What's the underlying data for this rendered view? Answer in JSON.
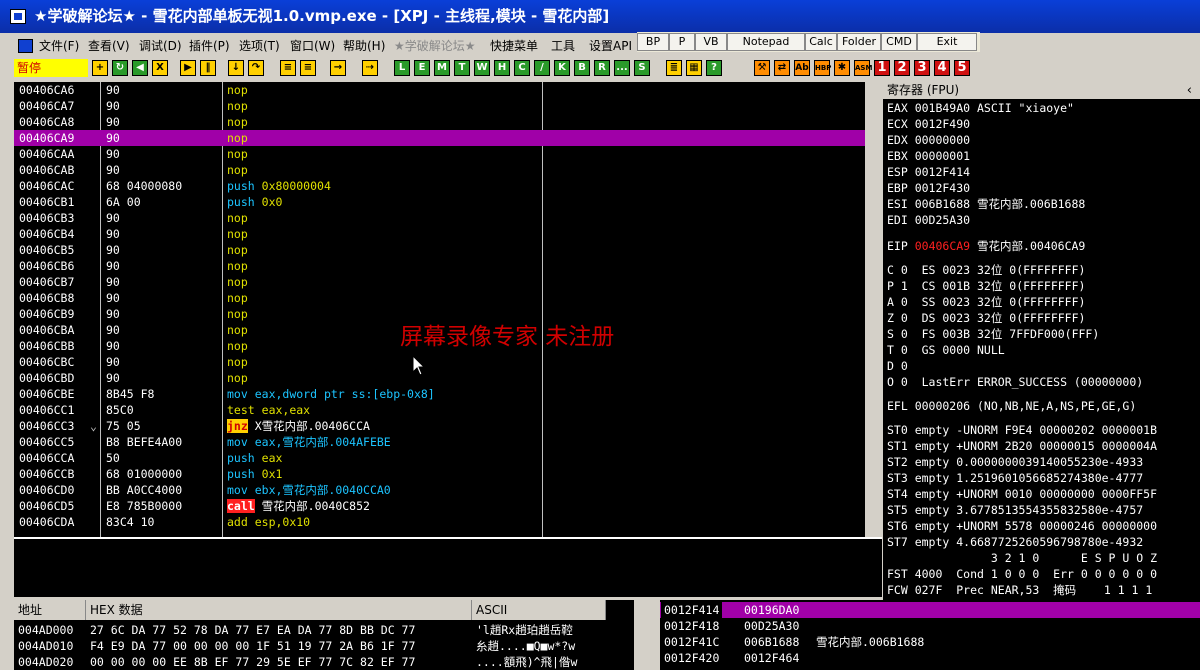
{
  "window": {
    "title": "★学破解论坛★ - 雪花内部单板无视1.0.vmp.exe - [XPJ - 主线程,模块 - 雪花内部]"
  },
  "menu": [
    {
      "label": "文件(F)",
      "disabled": false
    },
    {
      "label": "查看(V)",
      "disabled": false
    },
    {
      "label": "调试(D)",
      "disabled": false
    },
    {
      "label": "插件(P)",
      "disabled": false
    },
    {
      "label": "选项(T)",
      "disabled": false
    },
    {
      "label": "窗口(W)",
      "disabled": false
    },
    {
      "label": "帮助(H)",
      "disabled": false
    },
    {
      "label": "★学破解论坛★",
      "disabled": true
    },
    {
      "label": "快捷菜单",
      "disabled": false
    },
    {
      "label": "工具",
      "disabled": false
    },
    {
      "label": "设置API",
      "disabled": false
    }
  ],
  "plugin_buttons": [
    "BP",
    "P",
    "VB",
    "Notepad",
    "Calc",
    "Folder",
    "CMD",
    "Exit"
  ],
  "toolbar": {
    "status": "暂停",
    "letter_buttons": [
      "L",
      "E",
      "M",
      "T",
      "W",
      "H",
      "C",
      "/",
      "K",
      "B",
      "R",
      "...",
      "S"
    ],
    "number_buttons": [
      "1",
      "2",
      "3",
      "4",
      "5"
    ],
    "right_buttons": [
      "Ab",
      "HBP",
      "ASM"
    ]
  },
  "disassembly": [
    {
      "addr": "00406CA6",
      "hex": "90",
      "mnem": "nop",
      "op": "",
      "style": "plain"
    },
    {
      "addr": "00406CA7",
      "hex": "90",
      "mnem": "nop",
      "op": "",
      "style": "plain"
    },
    {
      "addr": "00406CA8",
      "hex": "90",
      "mnem": "nop",
      "op": "",
      "style": "plain"
    },
    {
      "addr": "00406CA9",
      "hex": "90",
      "mnem": "nop",
      "op": "",
      "style": "plain",
      "selected": true
    },
    {
      "addr": "00406CAA",
      "hex": "90",
      "mnem": "nop",
      "op": "",
      "style": "plain"
    },
    {
      "addr": "00406CAB",
      "hex": "90",
      "mnem": "nop",
      "op": "",
      "style": "plain"
    },
    {
      "addr": "00406CAC",
      "hex": "68 04000080",
      "mnem": "push",
      "op": "0x80000004",
      "style": "push"
    },
    {
      "addr": "00406CB1",
      "hex": "6A 00",
      "mnem": "push",
      "op": "0x0",
      "style": "push"
    },
    {
      "addr": "00406CB3",
      "hex": "90",
      "mnem": "nop",
      "op": "",
      "style": "plain"
    },
    {
      "addr": "00406CB4",
      "hex": "90",
      "mnem": "nop",
      "op": "",
      "style": "plain"
    },
    {
      "addr": "00406CB5",
      "hex": "90",
      "mnem": "nop",
      "op": "",
      "style": "plain"
    },
    {
      "addr": "00406CB6",
      "hex": "90",
      "mnem": "nop",
      "op": "",
      "style": "plain"
    },
    {
      "addr": "00406CB7",
      "hex": "90",
      "mnem": "nop",
      "op": "",
      "style": "plain"
    },
    {
      "addr": "00406CB8",
      "hex": "90",
      "mnem": "nop",
      "op": "",
      "style": "plain"
    },
    {
      "addr": "00406CB9",
      "hex": "90",
      "mnem": "nop",
      "op": "",
      "style": "plain"
    },
    {
      "addr": "00406CBA",
      "hex": "90",
      "mnem": "nop",
      "op": "",
      "style": "plain"
    },
    {
      "addr": "00406CBB",
      "hex": "90",
      "mnem": "nop",
      "op": "",
      "style": "plain"
    },
    {
      "addr": "00406CBC",
      "hex": "90",
      "mnem": "nop",
      "op": "",
      "style": "plain"
    },
    {
      "addr": "00406CBD",
      "hex": "90",
      "mnem": "nop",
      "op": "",
      "style": "plain"
    },
    {
      "addr": "00406CBE",
      "hex": "8B45 F8",
      "mnem": "mov",
      "op": "eax,dword ptr ss:[ebp-0x8]",
      "style": "mov"
    },
    {
      "addr": "00406CC1",
      "hex": "85C0",
      "mnem": "test",
      "op": "eax,eax",
      "style": "test"
    },
    {
      "addr": "00406CC3",
      "hex": "75 05",
      "mnem": "jnz",
      "op": "X雪花内部.00406CCA",
      "style": "jnz",
      "marker": "⌄"
    },
    {
      "addr": "00406CC5",
      "hex": "B8 BEFE4A00",
      "mnem": "mov",
      "op": "eax,雪花内部.004AFEBE",
      "style": "mov"
    },
    {
      "addr": "00406CCA",
      "hex": "50",
      "mnem": "push",
      "op": "eax",
      "style": "push"
    },
    {
      "addr": "00406CCB",
      "hex": "68 01000000",
      "mnem": "push",
      "op": "0x1",
      "style": "push"
    },
    {
      "addr": "00406CD0",
      "hex": "BB A0CC4000",
      "mnem": "mov",
      "op": "ebx,雪花内部.0040CCA0",
      "style": "mov"
    },
    {
      "addr": "00406CD5",
      "hex": "E8 785B0000",
      "mnem": "call",
      "op": "雪花内部.0040C852",
      "style": "call"
    },
    {
      "addr": "00406CDA",
      "hex": "83C4 10",
      "mnem": "add",
      "op": "esp,0x10",
      "style": "add"
    }
  ],
  "watermark": "屏幕录像专家  未注册",
  "registers": {
    "header": "寄存器 (FPU)",
    "lines": [
      "EAX 001B49A0 ASCII \"xiaoye\"",
      "ECX 0012F490",
      "EDX 00000000",
      "EBX 00000001",
      "ESP 0012F414",
      "EBP 0012F430",
      "ESI 006B1688 雪花内部.006B1688",
      "EDI 00D25A30"
    ],
    "eip_label": "EIP",
    "eip_value": "00406CA9",
    "eip_rest": "雪花内部.00406CA9",
    "flags": [
      "C 0  ES 0023 32位 0(FFFFFFFF)",
      "P 1  CS 001B 32位 0(FFFFFFFF)",
      "A 0  SS 0023 32位 0(FFFFFFFF)",
      "Z 0  DS 0023 32位 0(FFFFFFFF)",
      "S 0  FS 003B 32位 7FFDF000(FFF)",
      "T 0  GS 0000 NULL",
      "D 0",
      "O 0  LastErr ERROR_SUCCESS (00000000)"
    ],
    "efl": "EFL 00000206 (NO,NB,NE,A,NS,PE,GE,G)",
    "fpu": [
      "ST0 empty -UNORM F9E4 00000202 0000001B",
      "ST1 empty +UNORM 2B20 00000015 0000004A",
      "ST2 empty 0.0000000039140055230e-4933",
      "ST3 empty 1.2519601056685274380e-4777",
      "ST4 empty +UNORM 0010 00000000 0000FF5F",
      "ST5 empty 3.6778513554355832580e-4757",
      "ST6 empty +UNORM 5578 00000246 00000000",
      "ST7 empty 4.6687725260596798780e-4932"
    ],
    "fst_hdr": "               3 2 1 0      E S P U O Z",
    "fst": "FST 4000  Cond 1 0 0 0  Err 0 0 0 0 0 0",
    "fcw": "FCW 027F  Prec NEAR,53  掩码    1 1 1 1"
  },
  "dump": {
    "headers": {
      "addr": "地址",
      "hex": "HEX 数据",
      "ascii": "ASCII"
    },
    "rows": [
      {
        "addr": "004AD000",
        "hex": "27 6C DA 77 52 78 DA 77 E7 EA DA 77 8D BB DC 77",
        "ascii": "'l趙Rx趙珀趙岳鞚"
      },
      {
        "addr": "004AD010",
        "hex": "F4 E9 DA 77 00 00 00 00 1F 51 19 77 2A B6 1F 77",
        "ascii": "糸趙....■Q■w*?w"
      },
      {
        "addr": "004AD020",
        "hex": "00 00 00 00 EE 8B EF 77 29 5E EF 77 7C 82 EF 77",
        "ascii": "....額飛)^飛|偺w"
      }
    ]
  },
  "stack": [
    {
      "addr": "0012F414",
      "value": "00196DA0",
      "comment": "",
      "selected": true
    },
    {
      "addr": "0012F418",
      "value": "00D25A30",
      "comment": ""
    },
    {
      "addr": "0012F41C",
      "value": "006B1688",
      "comment": "雪花内部.006B1688"
    },
    {
      "addr": "0012F420",
      "value": "0012F464",
      "comment": ""
    }
  ]
}
